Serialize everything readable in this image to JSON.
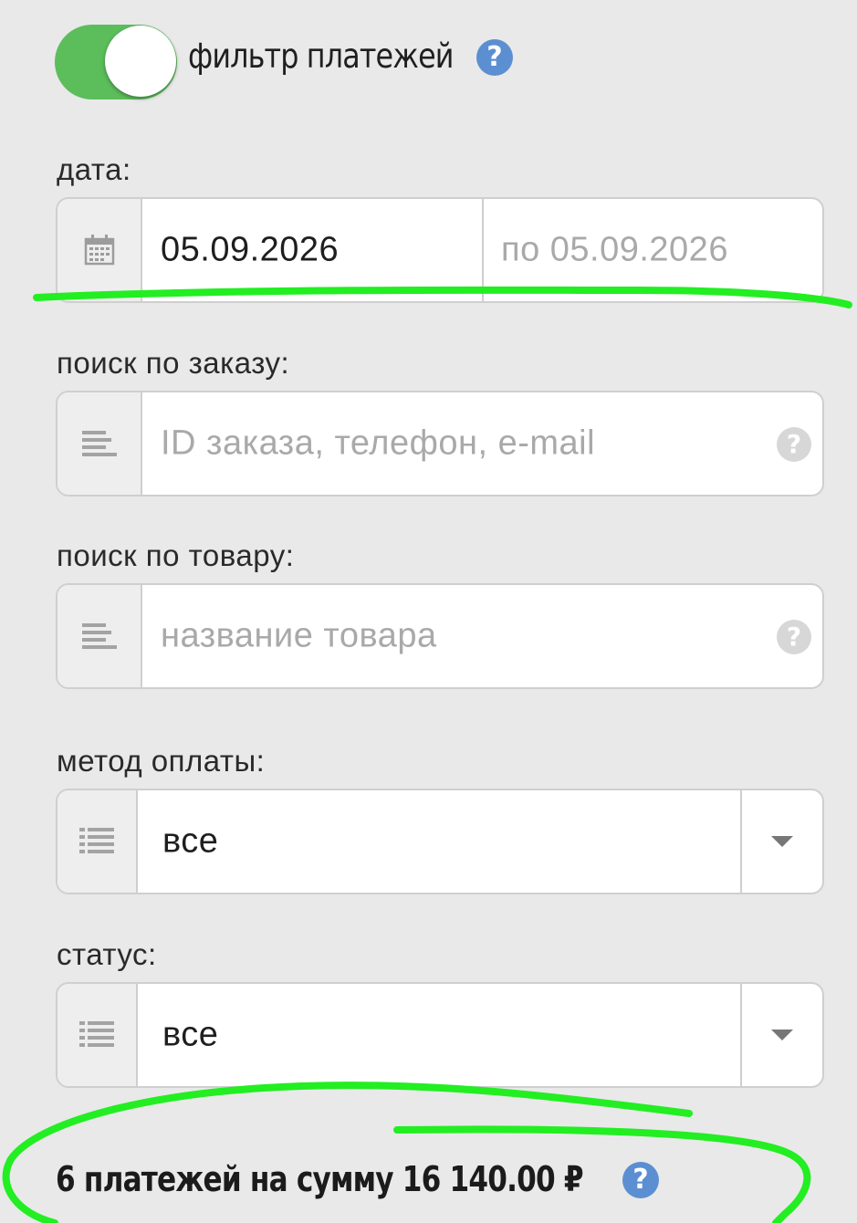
{
  "filter": {
    "label": "фильтр платежей",
    "enabled": true,
    "help_icon": "?"
  },
  "date": {
    "label": "дата:",
    "from_value": "05.09.2026",
    "to_placeholder": "по 05.09.2026",
    "icon": "calendar-icon"
  },
  "order_search": {
    "label": "поиск по заказу:",
    "placeholder": "ID заказа, телефон, e-mail",
    "icon": "text-lines-icon",
    "help_icon": "?"
  },
  "product_search": {
    "label": "поиск по товару:",
    "placeholder": "название товара",
    "icon": "text-lines-icon",
    "help_icon": "?"
  },
  "payment_method": {
    "label": "метод оплаты:",
    "value": "все",
    "icon": "list-icon"
  },
  "status": {
    "label": "статус:",
    "value": "все",
    "icon": "list-icon"
  },
  "summary": {
    "text": "6 платежей на сумму 16 140.00 ₽",
    "help_icon": "?"
  },
  "colors": {
    "toggle_on": "#5cbd5b",
    "help_blue": "#5b8fd2",
    "annotation": "#22ee22",
    "background": "#e9e9e9"
  }
}
